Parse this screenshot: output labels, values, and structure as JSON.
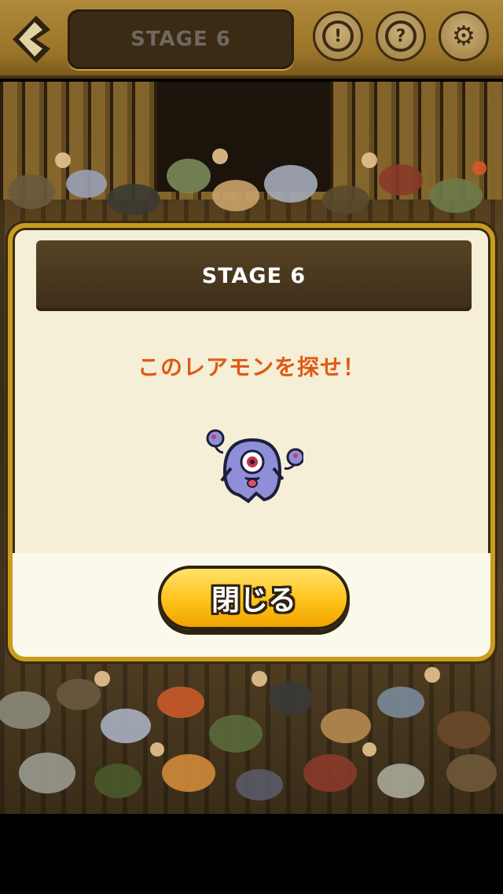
{
  "header": {
    "stage_title": "STAGE 6",
    "buttons": [
      {
        "icon": "back-arrow-icon"
      },
      {
        "icon": "magnifier-alert-icon",
        "glyph": "!"
      },
      {
        "icon": "hint-question-icon",
        "glyph": "?"
      },
      {
        "icon": "gear-icon",
        "glyph": "⚙"
      }
    ]
  },
  "dialog": {
    "title": "STAGE 6",
    "message": "このレアモンを探せ！",
    "target_icon": "one-eyed-ghost-monster-icon",
    "close_label": "閉じる"
  },
  "colors": {
    "frame_gold": "#c99b1e",
    "header_brown": "#3e2e18",
    "message_orange": "#e05a14",
    "button_yellow": "#ffc21a",
    "dialog_bg": "#f4efd6"
  }
}
